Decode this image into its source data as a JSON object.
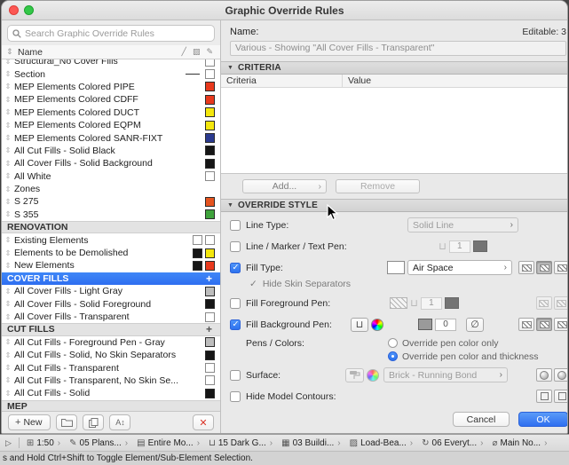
{
  "window": {
    "title": "Graphic Override Rules"
  },
  "search": {
    "placeholder": "Search Graphic Override Rules"
  },
  "icons": {
    "collapse": "▼",
    "drag": "⇕",
    "pen": "⊔",
    "no_pen": "∅",
    "check": "✓",
    "plus": "+",
    "delete": "✕",
    "rename": "A↕",
    "chevron": "›",
    "disclosure": "▷",
    "header_line": "╱",
    "header_fill": "▨",
    "header_pen": "✎"
  },
  "list": {
    "name_header": "Name",
    "swatch_colors": {
      "red": "#e8391d",
      "yellow": "#f4e70c",
      "blue": "#2b3a8f",
      "black": "#161616",
      "white": "#ffffff",
      "gray": "#bdbdbd",
      "orange": "#e5541f",
      "green": "#3fa33c"
    },
    "items": [
      {
        "label": "Structural_No Cover Fills",
        "kind": "rule",
        "swatches": [
          "white"
        ]
      },
      {
        "label": "Section",
        "kind": "rule",
        "line": true,
        "swatches": [
          "white"
        ]
      },
      {
        "label": "MEP Elements Colored PIPE",
        "kind": "rule",
        "swatches": [
          "red"
        ]
      },
      {
        "label": "MEP Elements Colored CDFF",
        "kind": "rule",
        "swatches": [
          "red"
        ]
      },
      {
        "label": "MEP Elements Colored DUCT",
        "kind": "rule",
        "swatches": [
          "yellow"
        ]
      },
      {
        "label": "MEP Elements Colored EQPM",
        "kind": "rule",
        "swatches": [
          "yellow"
        ]
      },
      {
        "label": "MEP Elements Colored SANR-FIXT",
        "kind": "rule",
        "swatches": [
          "blue"
        ]
      },
      {
        "label": "All Cut Fills - Solid Black",
        "kind": "rule",
        "swatches": [
          "black"
        ]
      },
      {
        "label": "All Cover Fills - Solid Background",
        "kind": "rule",
        "swatches": [
          "black"
        ]
      },
      {
        "label": "All White",
        "kind": "rule",
        "swatches": [
          "white"
        ]
      },
      {
        "label": "Zones",
        "kind": "rule",
        "swatches": []
      },
      {
        "label": "S 275",
        "kind": "rule",
        "swatches": [
          "orange"
        ]
      },
      {
        "label": "S 355",
        "kind": "rule",
        "swatches": [
          "green"
        ]
      },
      {
        "label": "RENOVATION",
        "kind": "header"
      },
      {
        "label": "Existing Elements",
        "kind": "rule",
        "swatches": [
          "white",
          "white"
        ]
      },
      {
        "label": "Elements to be Demolished",
        "kind": "rule",
        "swatches": [
          "black",
          "yellow"
        ]
      },
      {
        "label": "New Elements",
        "kind": "rule",
        "swatches": [
          "black",
          "red"
        ]
      },
      {
        "label": "COVER FILLS",
        "kind": "header",
        "selected": true,
        "plus": true
      },
      {
        "label": "All Cover Fills - Light Gray",
        "kind": "rule",
        "swatches": [
          "gray"
        ]
      },
      {
        "label": "All Cover Fills - Solid Foreground",
        "kind": "rule",
        "swatches": [
          "black"
        ]
      },
      {
        "label": "All Cover Fills - Transparent",
        "kind": "rule",
        "swatches": [
          "white"
        ]
      },
      {
        "label": "CUT FILLS",
        "kind": "header",
        "plus": true
      },
      {
        "label": "All Cut Fills - Foreground Pen - Gray",
        "kind": "rule",
        "swatches": [
          "gray"
        ]
      },
      {
        "label": "All Cut Fills - Solid, No Skin Separators",
        "kind": "rule",
        "swatches": [
          "black"
        ]
      },
      {
        "label": "All Cut Fills - Transparent",
        "kind": "rule",
        "swatches": [
          "white"
        ]
      },
      {
        "label": "All Cut Fills - Transparent, No Skin Se...",
        "kind": "rule",
        "swatches": [
          "white"
        ]
      },
      {
        "label": "All Cut Fills - Solid",
        "kind": "rule",
        "swatches": [
          "black"
        ]
      },
      {
        "label": "MEP",
        "kind": "header"
      }
    ]
  },
  "list_toolbar": {
    "new": "New"
  },
  "detail": {
    "name_label": "Name:",
    "editable": "Editable: 3",
    "name_value": "Various - Showing \"All Cover Fills - Transparent\"",
    "criteria": {
      "title": "CRITERIA",
      "col_criteria": "Criteria",
      "col_value": "Value",
      "add": "Add...",
      "remove": "Remove"
    },
    "override": {
      "title": "OVERRIDE STYLE",
      "line_type": {
        "label": "Line Type:",
        "value": "Solid Line",
        "checked": false
      },
      "line_pen": {
        "label": "Line / Marker / Text Pen:",
        "pen": "1",
        "checked": false
      },
      "fill_type": {
        "label": "Fill Type:",
        "value": "Air Space",
        "checked": true
      },
      "hide_skin": {
        "label": "Hide Skin Separators",
        "checked": true
      },
      "fill_fg": {
        "label": "Fill Foreground Pen:",
        "pen": "1",
        "checked": false
      },
      "fill_bg": {
        "label": "Fill Background Pen:",
        "pen": "0",
        "checked": true
      },
      "pens_colors": {
        "label": "Pens / Colors:",
        "options": [
          "Override pen color only",
          "Override pen color and thickness"
        ],
        "selected": 1
      },
      "surface": {
        "label": "Surface:",
        "value": "Brick - Running Bond",
        "checked": false
      },
      "hide_contours": {
        "label": "Hide Model Contours:",
        "checked": false
      }
    },
    "cancel": "Cancel",
    "ok": "OK"
  },
  "statusbar": {
    "items": [
      {
        "name": "quick-options-scale",
        "icon": "scale-icon",
        "glyph": "⊞",
        "label": "1:50"
      },
      {
        "name": "quick-options-layer-combination",
        "icon": "pen-set-icon",
        "glyph": "✎",
        "label": "05 Plans..."
      },
      {
        "name": "quick-options-structure-display",
        "icon": "layers-icon",
        "glyph": "▤",
        "label": "Entire Mo..."
      },
      {
        "name": "quick-options-pen-set",
        "icon": "pen-icon",
        "glyph": "⊔",
        "label": "15 Dark G..."
      },
      {
        "name": "quick-options-model-view",
        "icon": "model-view-icon",
        "glyph": "▦",
        "label": "03 Buildi..."
      },
      {
        "name": "quick-options-graphic-override",
        "icon": "override-icon",
        "glyph": "▨",
        "label": "Load-Bea..."
      },
      {
        "name": "quick-options-renovation-filter",
        "icon": "renovation-icon",
        "glyph": "↻",
        "label": "06 Everyt..."
      },
      {
        "name": "quick-options-dimensions",
        "icon": "dimension-icon",
        "glyph": "⌀",
        "label": "Main No..."
      }
    ]
  },
  "hint": "s and Hold Ctrl+Shift to Toggle Element/Sub-Element Selection."
}
